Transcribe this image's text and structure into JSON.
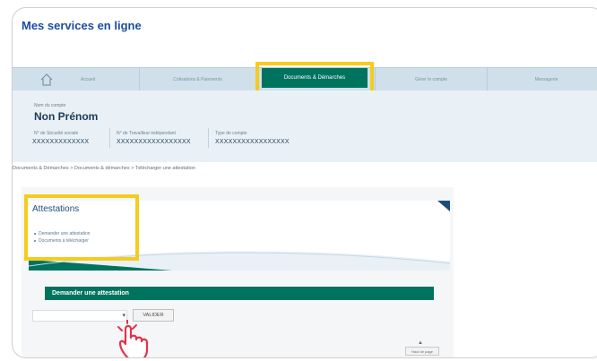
{
  "site": {
    "title": "Mes services en ligne"
  },
  "nav": {
    "items": [
      {
        "label": "Accueil"
      },
      {
        "label": "Cotisations & Paiements"
      },
      {
        "label": "Documents & Démarches"
      },
      {
        "label": "Gérer le compte"
      },
      {
        "label": "Messagerie"
      }
    ],
    "active_index": 2
  },
  "account": {
    "name_label": "Nom du compte",
    "name": "Non Prénom",
    "fields": [
      {
        "label": "N° de Sécurité sociale",
        "value": "XXXXXXXXXXXXX"
      },
      {
        "label": "N° de Travailleur indépendant",
        "value": "XXXXXXXXXXXXXXXXX"
      },
      {
        "label": "Type de compte",
        "value": "XXXXXXXXXXXXXXXXX"
      }
    ]
  },
  "breadcrumb": "Documents & Démarches > Documents & démarches > Télécharger une attestation",
  "attestations": {
    "title": "Attestations",
    "links": [
      "Demander une attestation",
      "Documents à télécharger"
    ]
  },
  "demander": {
    "title": "Demander une attestation",
    "select_value": "",
    "submit_label": "VALIDER"
  },
  "back_to_top_label": "Haut de page",
  "colors": {
    "brand_blue": "#1a4ea0",
    "active_green": "#00735f",
    "highlight_yellow": "#f5cc1d",
    "hand_red": "#e0344a"
  },
  "icons": [
    "home-icon",
    "chevron-down-icon",
    "pointer-hand-icon",
    "arrow-up-icon"
  ]
}
